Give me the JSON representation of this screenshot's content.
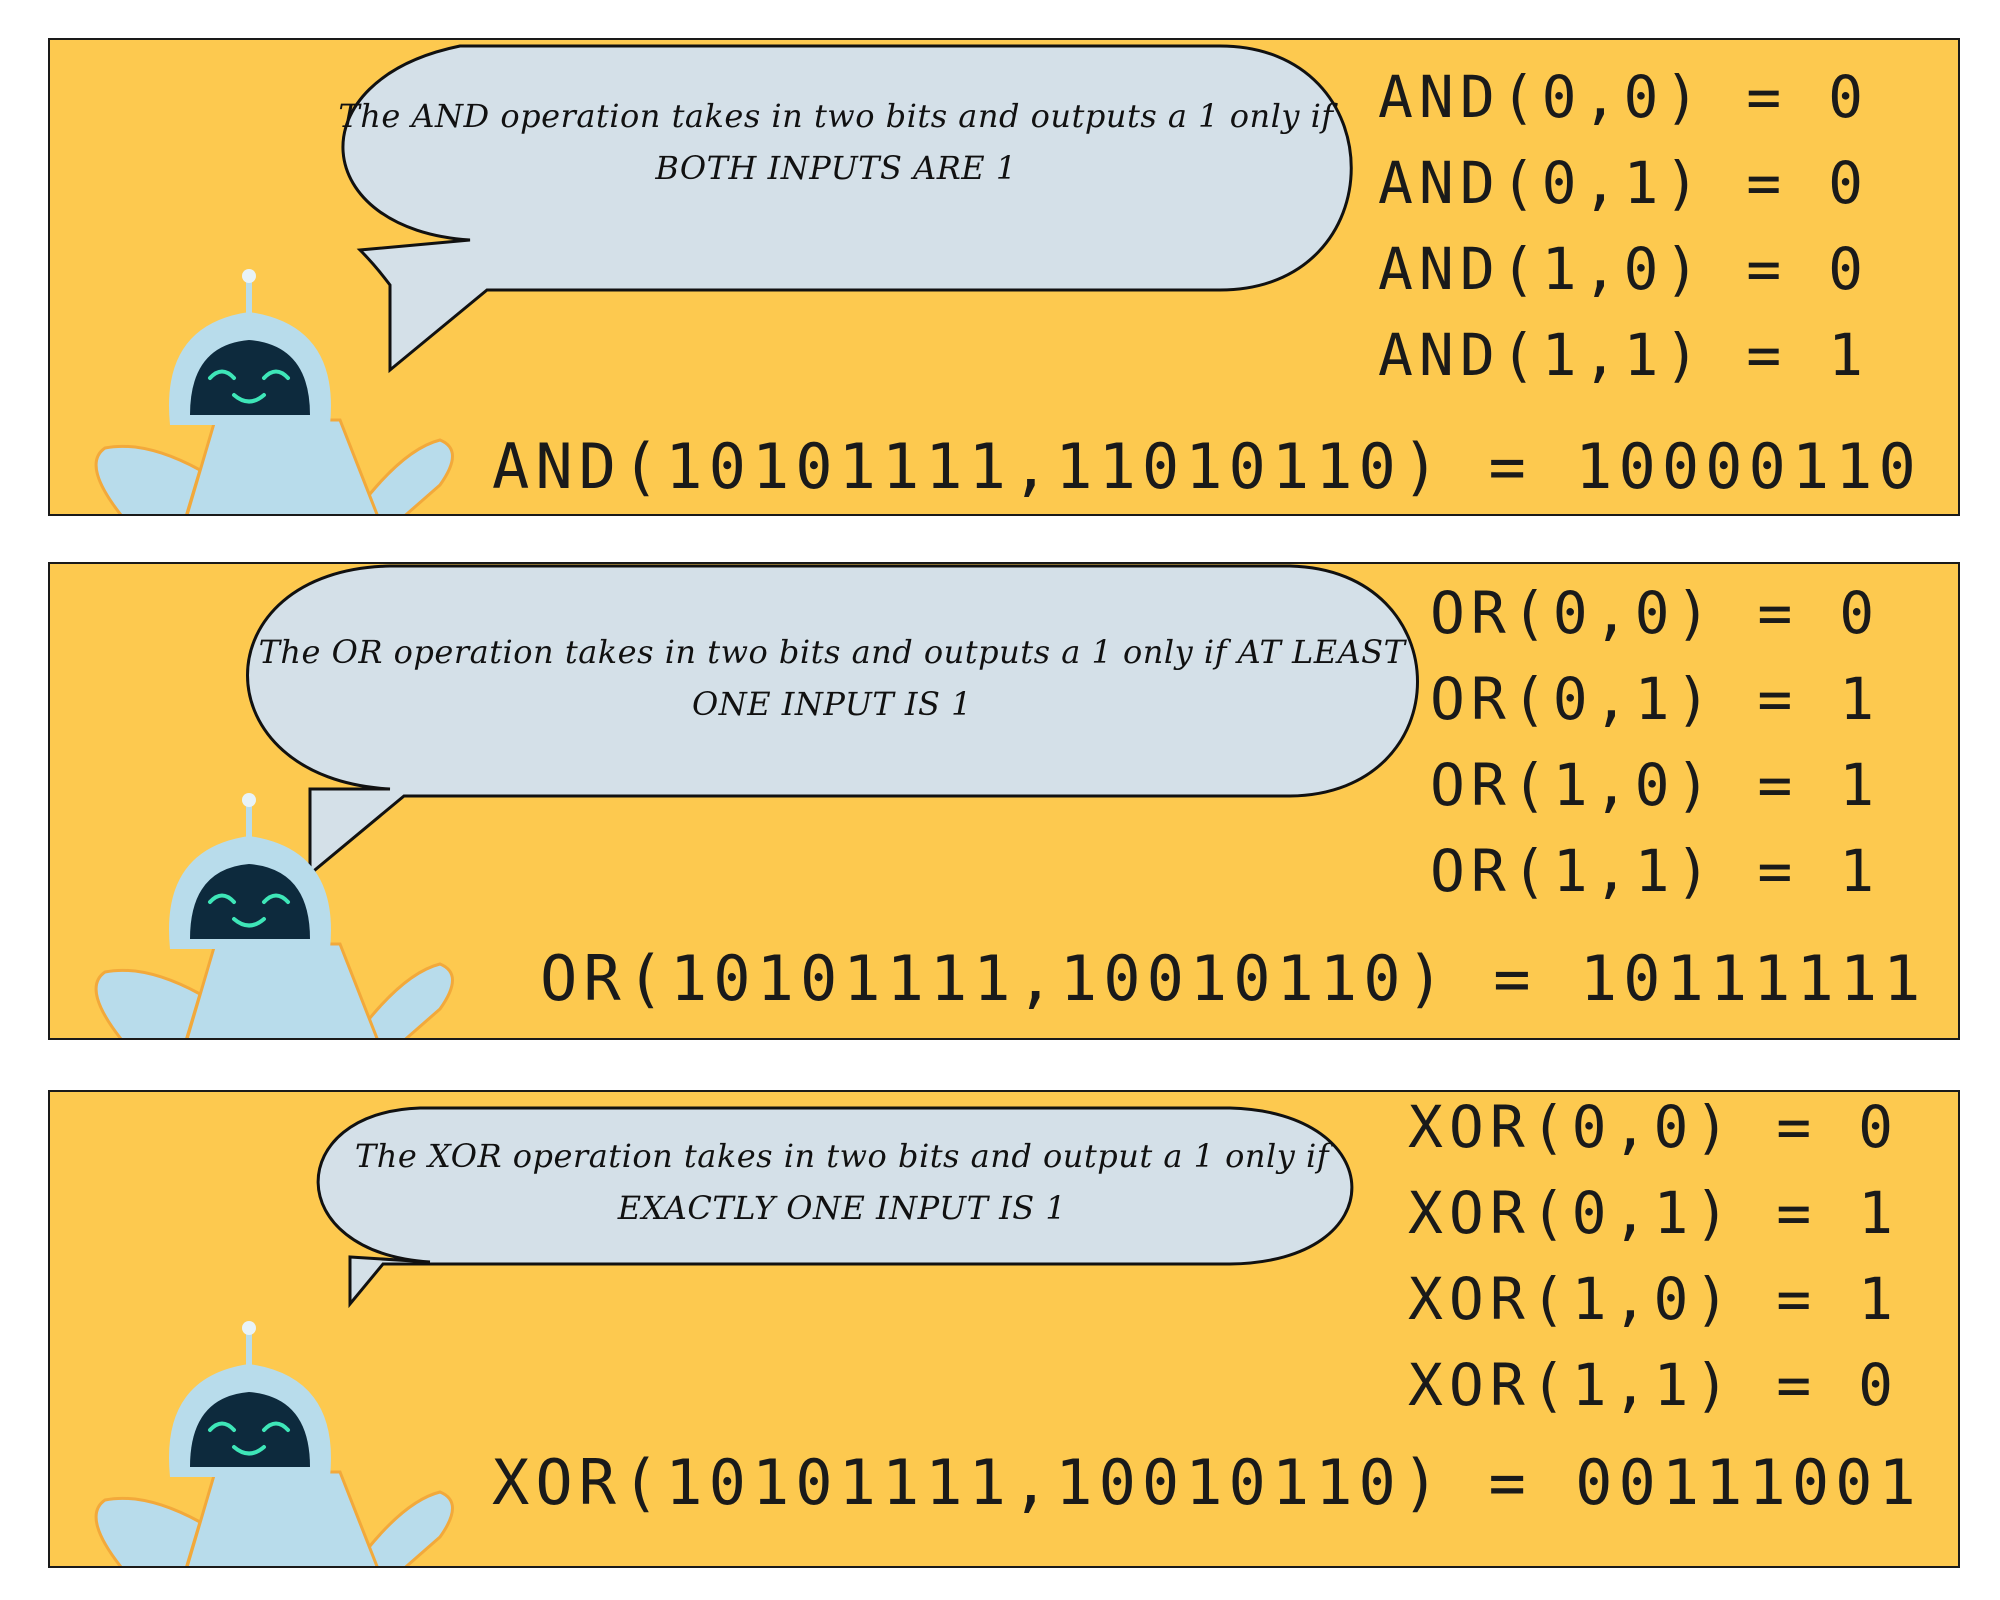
{
  "colors": {
    "panel_background": "#fdc94f",
    "bubble_fill": "#d4e0e8",
    "robot_body": "#b8dceb",
    "robot_face": "#0d2a3d",
    "robot_eyes": "#3ee6b8"
  },
  "panels": [
    {
      "operation": "AND",
      "bubble_text": "The AND operation takes in two bits and outputs a 1 only if BOTH INPUTS ARE 1",
      "truth_table": [
        "AND(0,0) = 0",
        "AND(0,1) = 0",
        "AND(1,0) = 0",
        "AND(1,1) = 1"
      ],
      "example": "AND(10101111,11010110) = 10000110",
      "mascot_icon": "robot-mascot-icon"
    },
    {
      "operation": "OR",
      "bubble_text": "The OR operation takes in two bits and outputs a 1 only if AT LEAST ONE INPUT IS 1",
      "truth_table": [
        "OR(0,0) = 0",
        "OR(0,1) = 1",
        "OR(1,0) = 1",
        "OR(1,1) = 1"
      ],
      "example": "OR(10101111,10010110) = 10111111",
      "mascot_icon": "robot-mascot-icon"
    },
    {
      "operation": "XOR",
      "bubble_text": "The XOR operation takes in two bits and output a 1 only if EXACTLY ONE INPUT IS 1",
      "truth_table": [
        "XOR(0,0) = 0",
        "XOR(0,1) = 1",
        "XOR(1,0) = 1",
        "XOR(1,1) = 0"
      ],
      "example": "XOR(10101111,10010110) = 00111001",
      "mascot_icon": "robot-mascot-icon"
    }
  ]
}
